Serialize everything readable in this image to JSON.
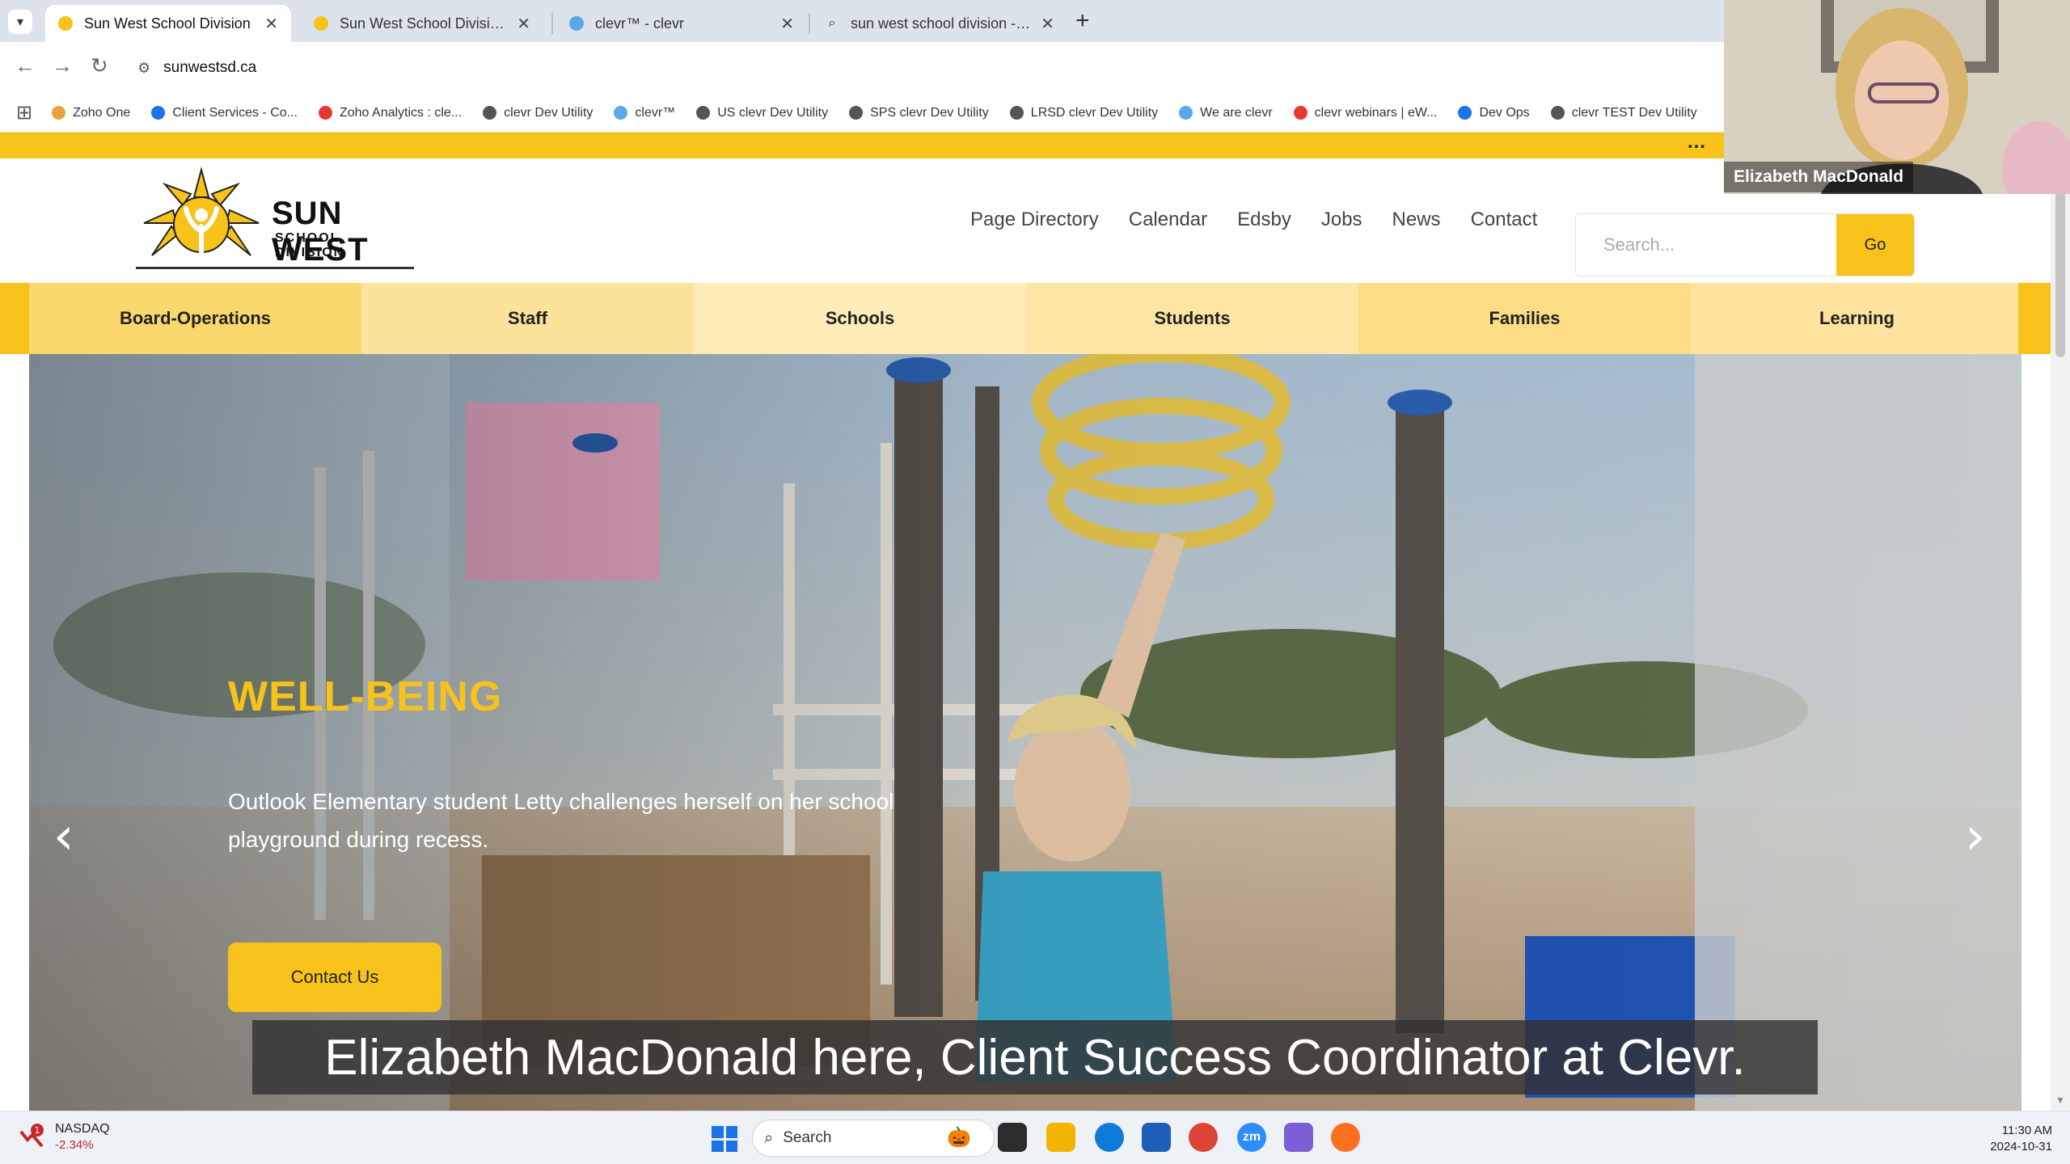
{
  "browser": {
    "tabs": [
      {
        "title": "Sun West School Division",
        "active": true
      },
      {
        "title": "Sun West School Division - Op",
        "active": false
      },
      {
        "title": "clevr™ - clevr",
        "active": false
      },
      {
        "title": "sun west school division - Searc",
        "active": false
      }
    ],
    "url": "sunwestsd.ca",
    "bookmarks": [
      "Zoho One",
      "Client Services - Co...",
      "Zoho Analytics : cle...",
      "clevr Dev Utility",
      "clevr™",
      "US clevr Dev Utility",
      "SPS clevr Dev Utility",
      "LRSD clevr Dev Utility",
      "We are clevr",
      "clevr webinars | eW...",
      "Dev Ops",
      "clevr TEST Dev Utility"
    ]
  },
  "site": {
    "logo": {
      "name": "SUN WEST",
      "sub": "SCHOOL DIVISION"
    },
    "top_nav": [
      "Page Directory",
      "Calendar",
      "Edsby",
      "Jobs",
      "News",
      "Contact"
    ],
    "search": {
      "placeholder": "Search...",
      "button": "Go"
    },
    "main_nav": [
      "Board-Operations",
      "Staff",
      "Schools",
      "Students",
      "Families",
      "Learning"
    ],
    "hero": {
      "title": "WELL-BEING",
      "text": "Outlook Elementary student Letty challenges herself on her school playground during recess.",
      "button": "Contact Us"
    }
  },
  "overlay": {
    "caption": "Elizabeth MacDonald here, Client Success Coordinator at Clevr.",
    "participant": "Elizabeth MacDonald"
  },
  "taskbar": {
    "stock_name": "NASDAQ",
    "stock_change": "-2.34%",
    "stock_badge": "1",
    "search": "Search",
    "time": "11:30 AM",
    "date": "2024-10-31"
  },
  "colors": {
    "brand_yellow": "#f7c31b",
    "nav_pale": "#fce7a8"
  }
}
